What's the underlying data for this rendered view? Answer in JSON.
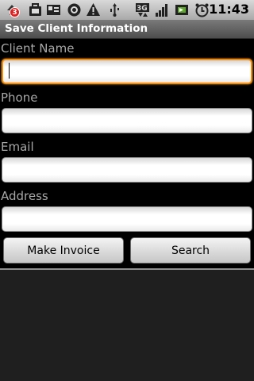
{
  "status_bar": {
    "time": "11:43",
    "notification_count": "3",
    "icons": [
      "notification-icon",
      "briefcase-icon",
      "card-icon",
      "at-icon",
      "warning-icon",
      "usb-icon",
      "3g-icon",
      "signal-icon",
      "battery-icon",
      "alarm-icon"
    ]
  },
  "title_bar": {
    "title": "Save Client Information"
  },
  "form": {
    "client_name_label": "Client Name",
    "phone_label": "Phone",
    "email_label": "Email",
    "address_label": "Address",
    "client_name_value": "",
    "phone_value": "",
    "email_value": "",
    "address_value": ""
  },
  "buttons": {
    "make_invoice": "Make Invoice",
    "search": "Search"
  },
  "colors": {
    "focus_border": "#ff8a00",
    "title_bar": "#5f5f5f"
  }
}
